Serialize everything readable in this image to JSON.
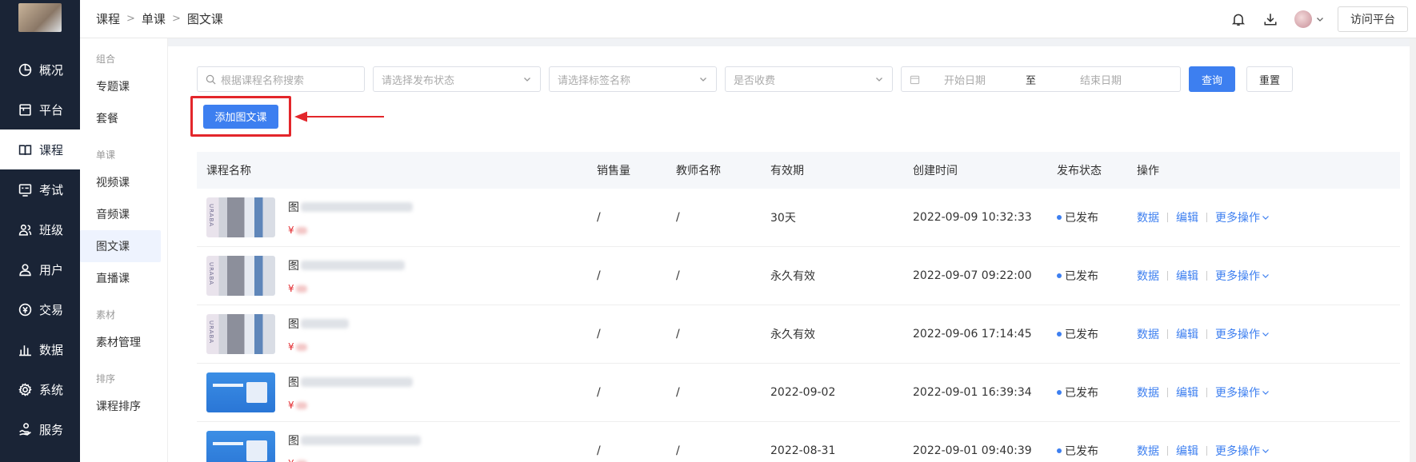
{
  "nav": {
    "items": [
      {
        "label": "概况",
        "icon": "dashboard-icon"
      },
      {
        "label": "平台",
        "icon": "store-icon"
      },
      {
        "label": "课程",
        "icon": "book-icon"
      },
      {
        "label": "考试",
        "icon": "exam-icon"
      },
      {
        "label": "班级",
        "icon": "class-icon"
      },
      {
        "label": "用户",
        "icon": "user-icon"
      },
      {
        "label": "交易",
        "icon": "trade-icon"
      },
      {
        "label": "数据",
        "icon": "chart-icon"
      },
      {
        "label": "系统",
        "icon": "gear-icon"
      },
      {
        "label": "服务",
        "icon": "service-icon"
      }
    ],
    "active_index": 2
  },
  "header": {
    "breadcrumb": [
      "课程",
      "单课",
      "图文课"
    ],
    "visit_button": "访问平台"
  },
  "subnav": {
    "groups": [
      {
        "title": "组合",
        "items": [
          "专题课",
          "套餐"
        ]
      },
      {
        "title": "单课",
        "items": [
          "视频课",
          "音频课",
          "图文课",
          "直播课"
        ]
      },
      {
        "title": "素材",
        "items": [
          "素材管理"
        ]
      },
      {
        "title": "排序",
        "items": [
          "课程排序"
        ]
      }
    ],
    "active": "图文课"
  },
  "filters": {
    "search_placeholder": "根据课程名称搜索",
    "status_placeholder": "请选择发布状态",
    "tag_placeholder": "请选择标签名称",
    "fee_placeholder": "是否收费",
    "start_date_placeholder": "开始日期",
    "date_separator": "至",
    "end_date_placeholder": "结束日期",
    "query_button": "查询",
    "reset_button": "重置"
  },
  "add_button": "添加图文课",
  "table": {
    "columns": [
      "课程名称",
      "销售量",
      "教师名称",
      "有效期",
      "创建时间",
      "发布状态",
      "操作"
    ],
    "rows": [
      {
        "thumb": "dress",
        "name_prefix": "图",
        "sales": "/",
        "teacher": "/",
        "valid": "30天",
        "created": "2022-09-09 10:32:33",
        "status": "已发布",
        "price_prefix": "¥"
      },
      {
        "thumb": "dress",
        "name_prefix": "图",
        "sales": "/",
        "teacher": "/",
        "valid": "永久有效",
        "created": "2022-09-07 09:22:00",
        "status": "已发布",
        "price_prefix": "¥"
      },
      {
        "thumb": "dress",
        "name_prefix": "图",
        "sales": "/",
        "teacher": "/",
        "valid": "永久有效",
        "created": "2022-09-06 17:14:45",
        "status": "已发布",
        "price_prefix": "¥"
      },
      {
        "thumb": "blue",
        "name_prefix": "图",
        "sales": "/",
        "teacher": "/",
        "valid": "2022-09-02",
        "created": "2022-09-01 16:39:34",
        "status": "已发布",
        "price_prefix": "¥"
      },
      {
        "thumb": "blue",
        "name_prefix": "图",
        "sales": "/",
        "teacher": "/",
        "valid": "2022-08-31",
        "created": "2022-09-01 09:40:39",
        "status": "已发布",
        "price_prefix": "¥"
      }
    ],
    "ops": {
      "data": "数据",
      "edit": "编辑",
      "more": "更多操作"
    }
  },
  "colors": {
    "primary": "#3d7ff0",
    "nav_bg": "#1a2436",
    "highlight": "#e3262b"
  }
}
